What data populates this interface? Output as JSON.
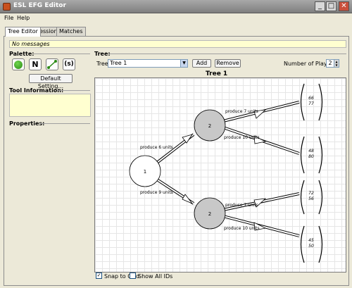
{
  "window": {
    "title": "ESL EFG Editor",
    "minimize": "_",
    "maximize": "□",
    "close": "✕"
  },
  "menu": {
    "file": "File",
    "help": "Help"
  },
  "tabs": [
    {
      "label": "Tree Editor",
      "active": true
    },
    {
      "label": "Session"
    },
    {
      "label": "Matches"
    }
  ],
  "messages": "No messages",
  "palette": {
    "title": "Palette:",
    "node_icon": "green-circle-icon",
    "nature_label": "N",
    "edge_icon": "edge-icon",
    "payoff_label": "(s)",
    "default_button": "Default Setting..."
  },
  "tool_info": {
    "title": "Tool Information:"
  },
  "properties": {
    "title": "Properties:"
  },
  "tree": {
    "section_title": "Tree:",
    "label": "Tree:",
    "selected": "Tree 1",
    "add_label": "Add",
    "remove_label": "Remove",
    "players_label": "Number of Players:",
    "players_value": "2",
    "display_title": "Tree 1"
  },
  "diagram": {
    "nodes": [
      {
        "label": "1",
        "fill": "#ffffff"
      },
      {
        "label": "2",
        "fill": "#c8c8c8"
      },
      {
        "label": "2",
        "fill": "#c8c8c8"
      }
    ],
    "edges": [
      "produce 6 units",
      "produce 9 units",
      "produce 7 units",
      "produce 10 units",
      "produce 7 units",
      "produce 10 units"
    ],
    "payoffs": [
      [
        "66",
        "77"
      ],
      [
        "48",
        "80"
      ],
      [
        "72",
        "56"
      ],
      [
        "45",
        "50"
      ]
    ]
  },
  "options": {
    "snap_label": "Snap to Grid",
    "snap_checked": true,
    "show_ids_label": "Show All IDs",
    "show_ids_checked": false
  }
}
